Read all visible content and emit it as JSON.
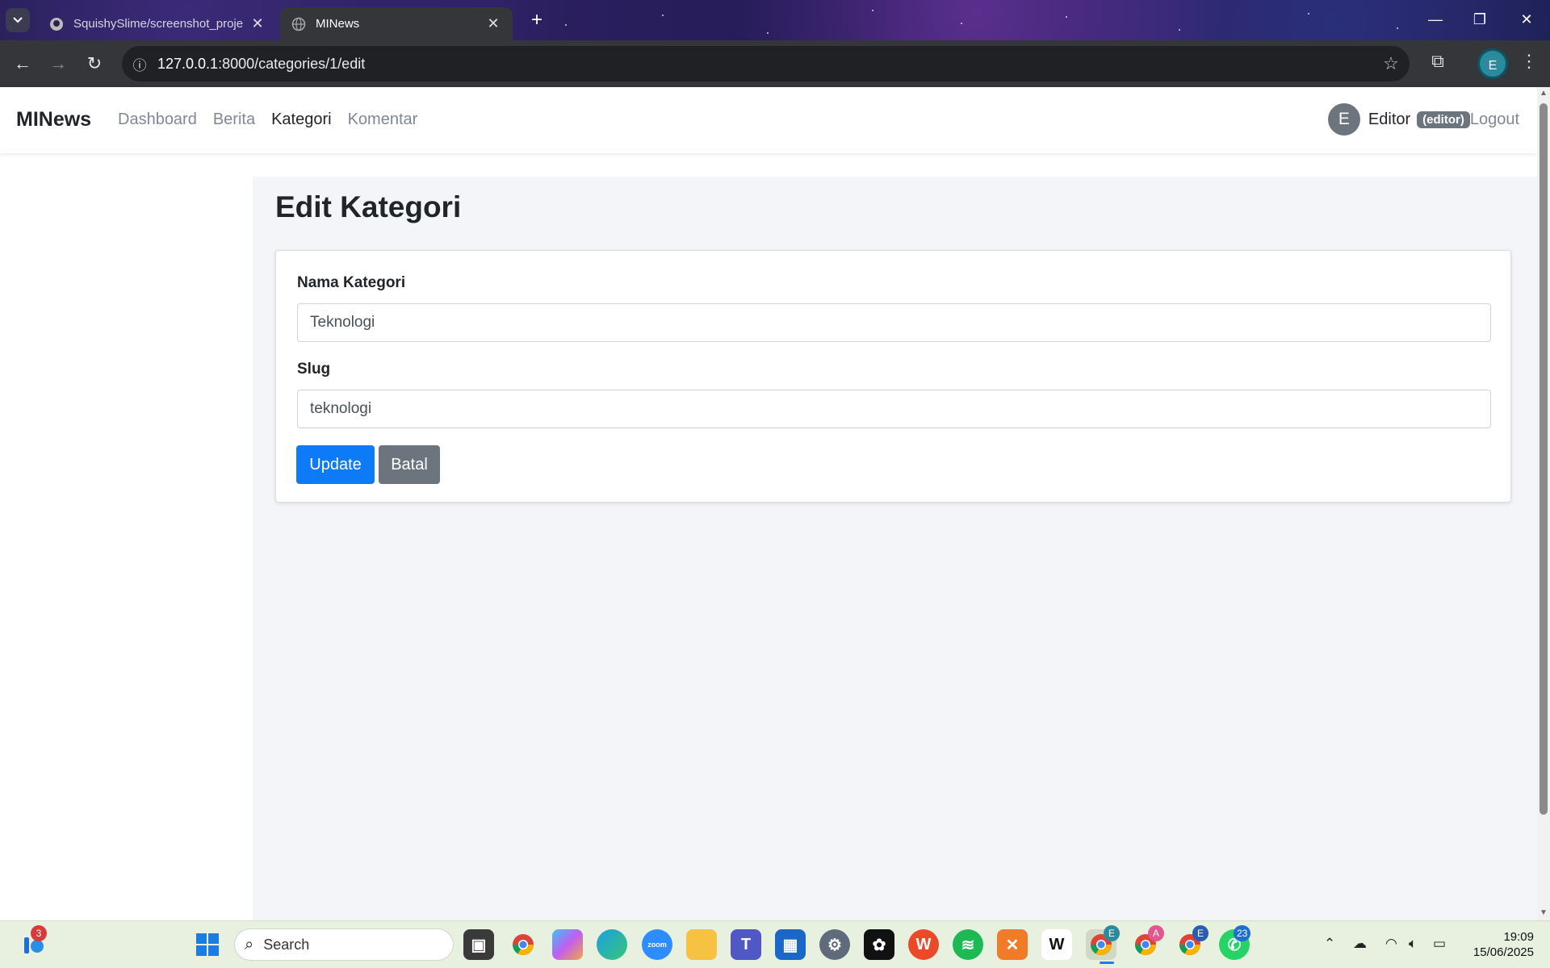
{
  "browser": {
    "tabs": [
      {
        "title": "SquishySlime/screenshot_proje",
        "active": false
      },
      {
        "title": "MINews",
        "active": true
      }
    ],
    "url_host": "127.0.0.1",
    "url_path": ":8000/categories/1/edit",
    "profile_initial": "E"
  },
  "app": {
    "brand": "MINews",
    "nav": [
      {
        "label": "Dashboard",
        "active": false
      },
      {
        "label": "Berita",
        "active": false
      },
      {
        "label": "Kategori",
        "active": true
      },
      {
        "label": "Komentar",
        "active": false
      }
    ],
    "user": {
      "avatar_initial": "E",
      "name": "Editor",
      "role_badge": "(editor)",
      "logout": "Logout"
    }
  },
  "form": {
    "heading": "Edit Kategori",
    "name_label": "Nama Kategori",
    "name_value": "Teknologi",
    "slug_label": "Slug",
    "slug_value": "teknologi",
    "update_label": "Update",
    "cancel_label": "Batal"
  },
  "taskbar": {
    "search_placeholder": "Search",
    "widget_badge": "3",
    "chrome_badge_1": "E",
    "chrome_badge_2": "A",
    "chrome_badge_3": "E",
    "whatsapp_badge": "23",
    "time": "19:09",
    "date": "15/06/2025"
  },
  "colors": {
    "primary": "#0d7bf7",
    "secondary": "#6c757d",
    "page_bg": "#f4f5f8"
  }
}
